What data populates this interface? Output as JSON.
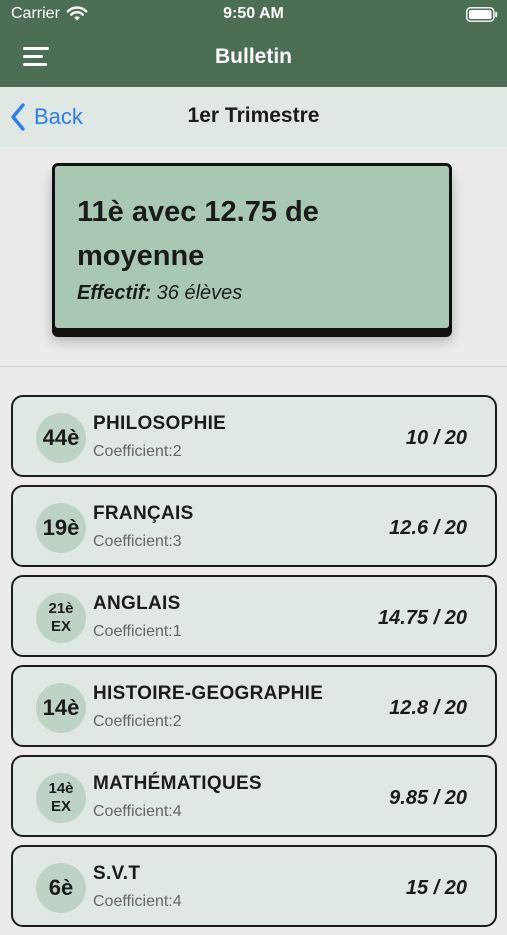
{
  "status_bar": {
    "carrier": "Carrier",
    "time": "9:50 AM"
  },
  "header": {
    "title": "Bulletin"
  },
  "subnav": {
    "back_label": "Back",
    "title": "1er Trimestre"
  },
  "summary": {
    "headline": "11è avec 12.75 de moyenne",
    "effectif_label": "Effectif:",
    "effectif_value": "36 élèves"
  },
  "subjects": [
    {
      "rank": "44è",
      "ex": "",
      "name": "PHILOSOPHIE",
      "coefficient": "Coefficient:2",
      "grade": "10 / 20"
    },
    {
      "rank": "19è",
      "ex": "",
      "name": "FRANÇAIS",
      "coefficient": "Coefficient:3",
      "grade": "12.6 / 20"
    },
    {
      "rank": "21è",
      "ex": "EX",
      "name": "ANGLAIS",
      "coefficient": "Coefficient:1",
      "grade": "14.75 / 20"
    },
    {
      "rank": "14è",
      "ex": "",
      "name": "HISTOIRE-GEOGRAPHIE",
      "coefficient": "Coefficient:2",
      "grade": "12.8 / 20"
    },
    {
      "rank": "14è",
      "ex": "EX",
      "name": "MATHÉMATIQUES",
      "coefficient": "Coefficient:4",
      "grade": "9.85 / 20"
    },
    {
      "rank": "6è",
      "ex": "",
      "name": "S.V.T",
      "coefficient": "Coefficient:4",
      "grade": "15 / 20"
    }
  ],
  "colors": {
    "header": "#4b6e55",
    "card": "#a9c8b3",
    "row": "#dfe8e2",
    "badge": "#bfd3c4",
    "link": "#2c7df4"
  }
}
